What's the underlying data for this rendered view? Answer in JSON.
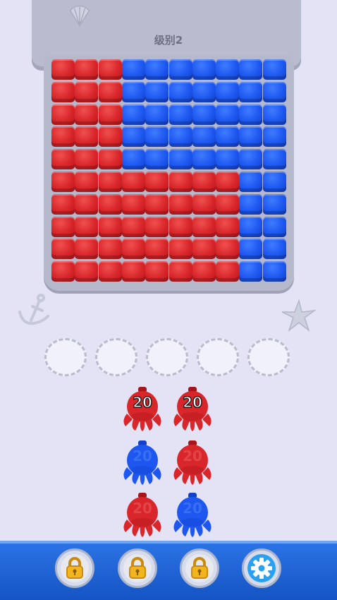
{
  "game": {
    "level_label": "级别2",
    "colors": {
      "red": "#d8262a",
      "blue": "#1d57f0",
      "background": "#e4e3f6",
      "bar": "#1f62d6"
    }
  },
  "board": {
    "rows": 10,
    "cols": 10,
    "grid": [
      "RRRBBBBBBB",
      "RRRBBBBBBB",
      "RRRBBBBBBB",
      "RRRBBBBBBB",
      "RRRBBBBBBB",
      "RRRRRRRRBB",
      "RRRRRRRRBB",
      "RRRRRRRRBB",
      "RRRRRRRRBB",
      "RRRRRRRRBB"
    ]
  },
  "slots": {
    "count": 5,
    "filled": 0
  },
  "shooters": [
    [
      {
        "color": "red",
        "count": "20",
        "active": true
      },
      {
        "color": "red",
        "count": "20",
        "active": true
      }
    ],
    [
      {
        "color": "blue",
        "count": "20",
        "active": false
      },
      {
        "color": "red",
        "count": "20",
        "active": false
      }
    ],
    [
      {
        "color": "red",
        "count": "20",
        "active": false
      },
      {
        "color": "blue",
        "count": "20",
        "active": false
      }
    ]
  ],
  "toolbar": {
    "buttons": [
      {
        "name": "locked-button-1",
        "icon": "lock-icon"
      },
      {
        "name": "locked-button-2",
        "icon": "lock-icon"
      },
      {
        "name": "locked-button-3",
        "icon": "lock-icon"
      },
      {
        "name": "settings-button",
        "icon": "gear-icon"
      }
    ]
  }
}
